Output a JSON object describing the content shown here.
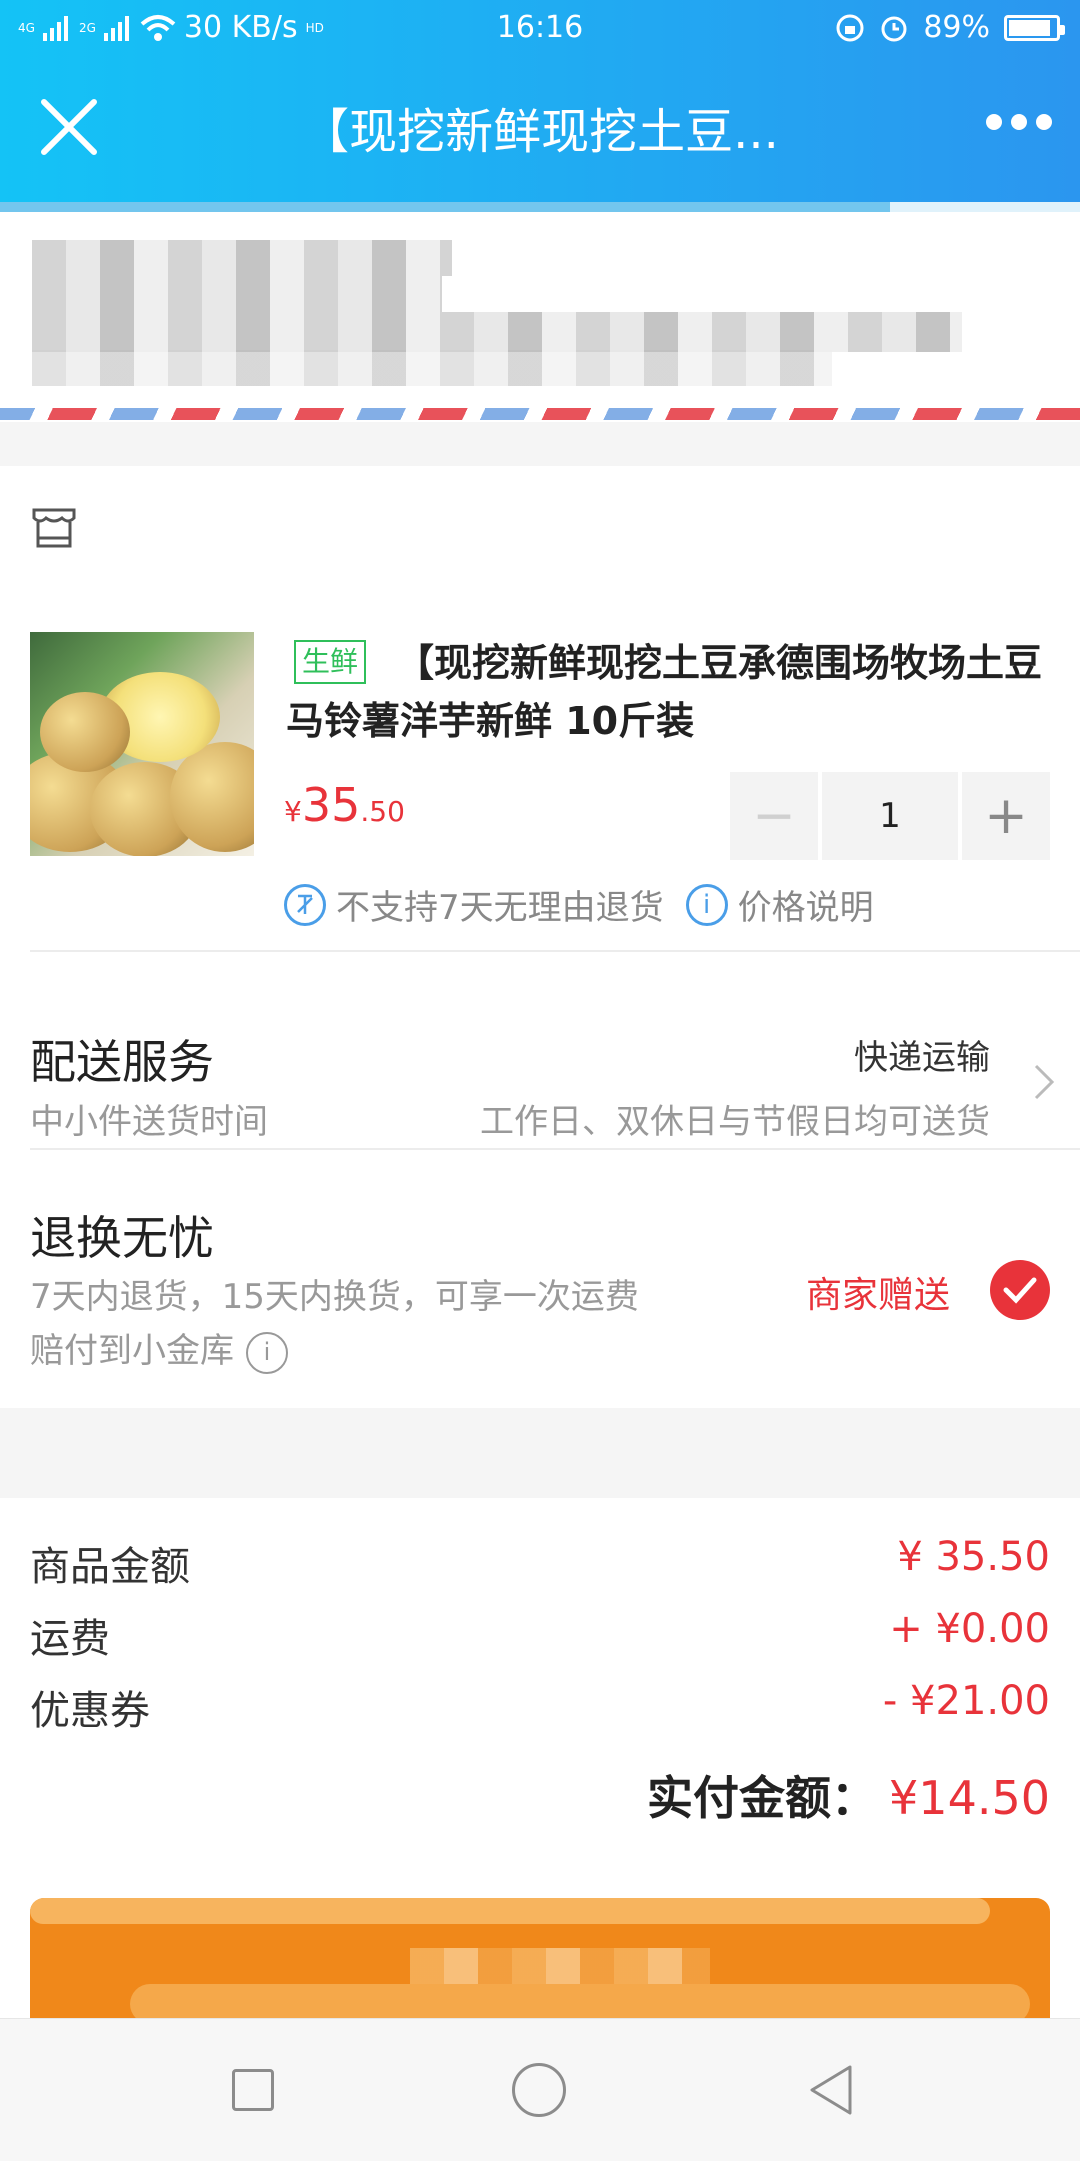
{
  "status_bar": {
    "network1": "4G",
    "network2": "2G",
    "speed": "30 KB/s",
    "hd": "HD",
    "time": "16:16",
    "battery": "89%",
    "battery_level": 0.89
  },
  "header": {
    "title": "【现挖新鲜现挖土豆..."
  },
  "product": {
    "tag": "生鲜",
    "title": "【现挖新鲜现挖土豆承德围场牧场土豆马铃薯洋芋新鲜 10斤装",
    "currency": "¥",
    "price_int": "35",
    "price_dec": ".50",
    "quantity": "1",
    "minus": "−",
    "plus": "+",
    "note_no_return": "不支持7天无理由退货",
    "note_price": "价格说明"
  },
  "delivery": {
    "label": "配送服务",
    "sub": "中小件送货时间",
    "method": "快递运输",
    "time": "工作日、双休日与节假日均可送货"
  },
  "returns": {
    "label": "退换无忧",
    "desc": "7天内退货，15天内换货，可享一次运费赔付到小金库",
    "gift": "商家赠送"
  },
  "summary": {
    "rows": [
      {
        "label": "商品金额",
        "value": "¥ 35.50"
      },
      {
        "label": "运费",
        "value": "+ ¥0.00"
      },
      {
        "label": "优惠券",
        "value": "- ¥21.00"
      }
    ],
    "total_label": "实付金额：",
    "total_value": "¥14.50"
  },
  "colors": {
    "header": "#1fb0f3",
    "price_red": "#e8333a",
    "fresh_green": "#2fbf5a",
    "pay_orange": "#f0881a"
  }
}
